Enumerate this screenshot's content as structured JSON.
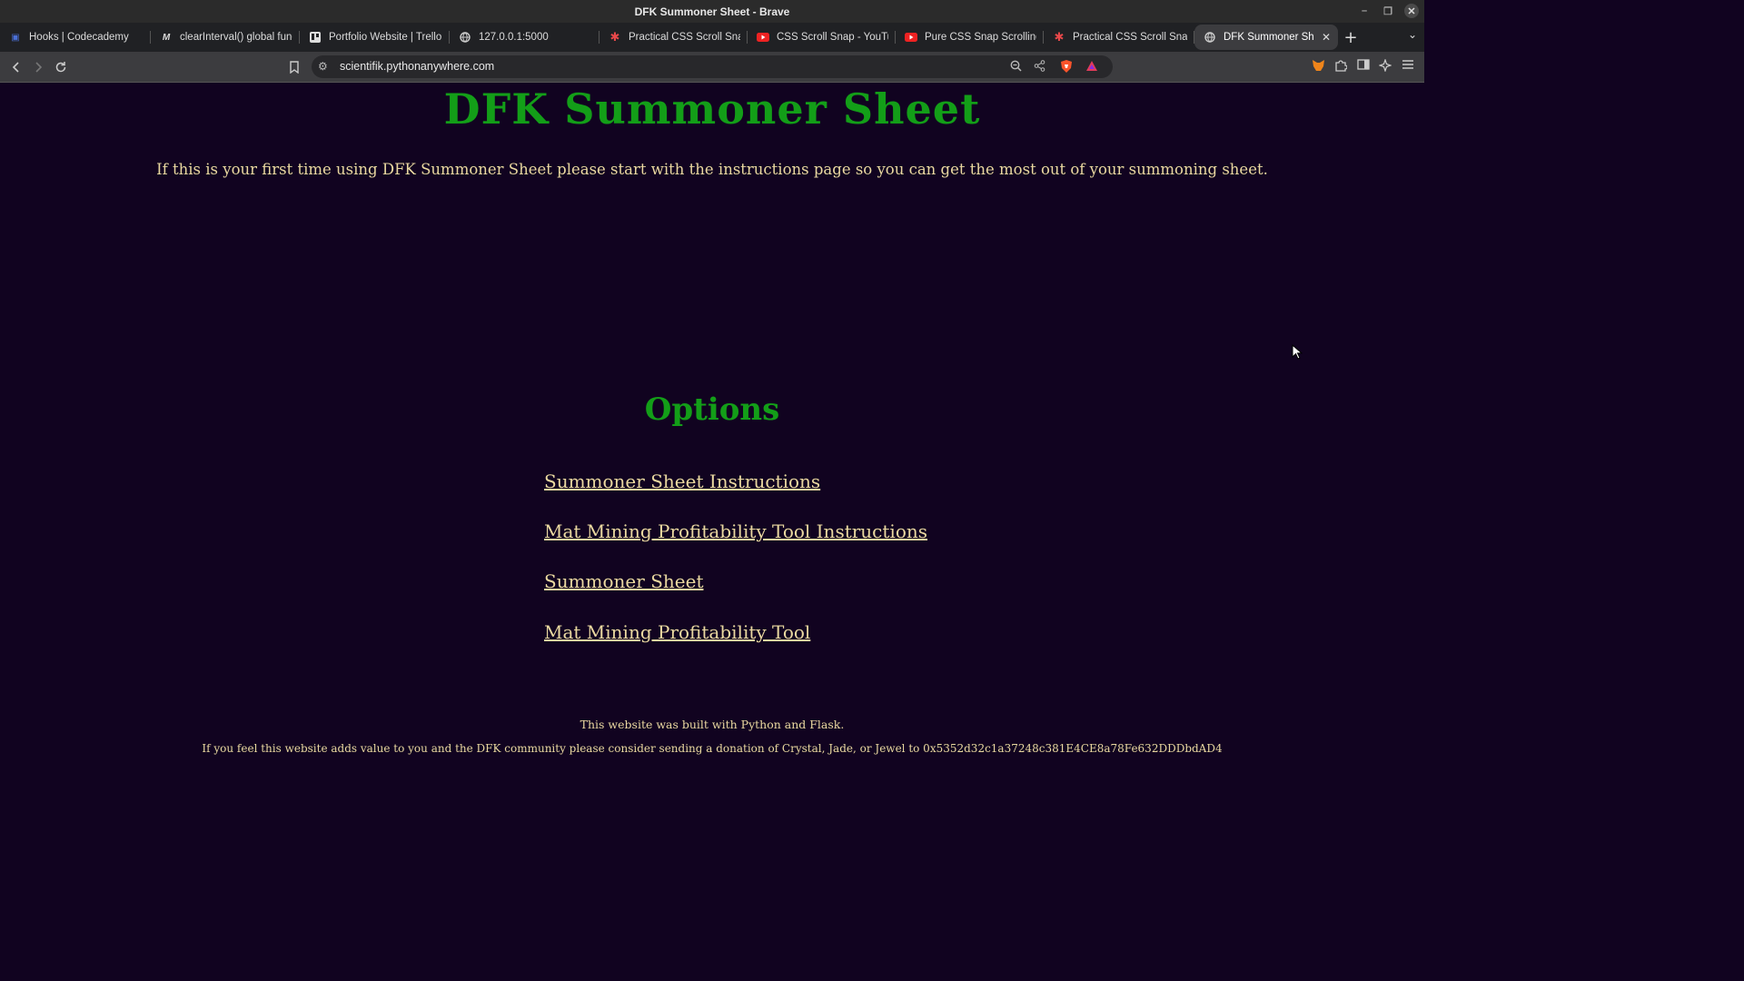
{
  "window": {
    "title": "DFK Summoner Sheet - Brave"
  },
  "tabs": [
    {
      "title": "Hooks | Codecademy",
      "icon": "codecademy-icon"
    },
    {
      "title": "clearInterval() global func",
      "icon": "mdn-icon"
    },
    {
      "title": "Portfolio Website | Trello",
      "icon": "trello-icon"
    },
    {
      "title": "127.0.0.1:5000",
      "icon": "globe-icon"
    },
    {
      "title": "Practical CSS Scroll Snapp",
      "icon": "css-tricks-icon"
    },
    {
      "title": "CSS Scroll Snap - YouTube",
      "icon": "youtube-icon"
    },
    {
      "title": "Pure CSS Snap Scrolling T",
      "icon": "youtube-icon"
    },
    {
      "title": "Practical CSS Scroll Snapp",
      "icon": "css-tricks-icon"
    },
    {
      "title": "DFK Summoner Sheet",
      "icon": "globe-icon",
      "active": true
    }
  ],
  "toolbar": {
    "url": "scientifik.pythonanywhere.com"
  },
  "page": {
    "title": "DFK Summoner Sheet",
    "intro": "If this is your first time using DFK Summoner Sheet please start with the instructions page so you can get the most out of your summoning sheet.",
    "options_heading": "Options",
    "links": [
      "Summoner Sheet Instructions",
      "Mat Mining Profitability Tool Instructions",
      "Summoner Sheet",
      "Mat Mining Profitability Tool"
    ],
    "footer_built": "This website was built with Python and Flask.",
    "footer_donation": "If you feel this website adds value to you and the DFK community please consider sending a donation of Crystal, Jade, or Jewel to 0x5352d32c1a37248c381E4CE8a78Fe632DDDbdAD4"
  },
  "colors": {
    "background": "#110320",
    "heading": "#139e18",
    "text": "#ead9a0"
  }
}
